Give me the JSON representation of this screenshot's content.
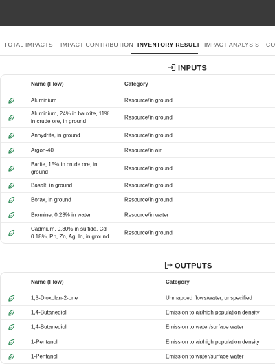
{
  "tabs": [
    {
      "label": "TOTAL IMPACTS"
    },
    {
      "label": "IMPACT CONTRIBUTION"
    },
    {
      "label": "INVENTORY RESULT"
    },
    {
      "label": "IMPACT ANALYSIS"
    },
    {
      "label": "CO"
    }
  ],
  "active_tab": "INVENTORY RESULT",
  "colors": {
    "accent": "#3a3a3a",
    "leaf": "#2e8b57"
  },
  "inputs": {
    "title": "INPUTS",
    "icon": "login-icon",
    "headers": {
      "name": "Name (Flow)",
      "category": "Category"
    },
    "rows": [
      {
        "name": "Aluminium",
        "category": "Resource/in ground"
      },
      {
        "name": "Aluminium, 24% in bauxite, 11%",
        "name2": "in crude ore, in ground",
        "category": "Resource/in ground"
      },
      {
        "name": "Anhydrite, in ground",
        "category": "Resource/in ground"
      },
      {
        "name": "Argon-40",
        "category": "Resource/in air"
      },
      {
        "name": "Barite, 15% in crude ore, in",
        "name2": "ground",
        "category": "Resource/in ground"
      },
      {
        "name": "Basalt, in ground",
        "category": "Resource/in ground"
      },
      {
        "name": "Borax, in ground",
        "category": "Resource/in ground"
      },
      {
        "name": "Bromine, 0.23% in water",
        "category": "Resource/in water"
      },
      {
        "name": "Cadmium, 0.30% in sulfide, Cd",
        "name2": "0.18%, Pb, Zn, Ag, In, in ground",
        "category": "Resource/in ground"
      }
    ]
  },
  "outputs": {
    "title": "OUTPUTS",
    "icon": "logout-icon",
    "headers": {
      "name": "Name (Flow)",
      "category": "Category"
    },
    "rows": [
      {
        "name": "1,3-Dioxolan-2-one",
        "category": "Unmapped flows/water, unspecified"
      },
      {
        "name": "1,4-Butanediol",
        "category": "Emission to air/high population density"
      },
      {
        "name": "1,4-Butanediol",
        "category": "Emission to water/surface water"
      },
      {
        "name": "1-Pentanol",
        "category": "Emission to air/high population density"
      },
      {
        "name": "1-Pentanol",
        "category": "Emission to water/surface water"
      }
    ]
  }
}
